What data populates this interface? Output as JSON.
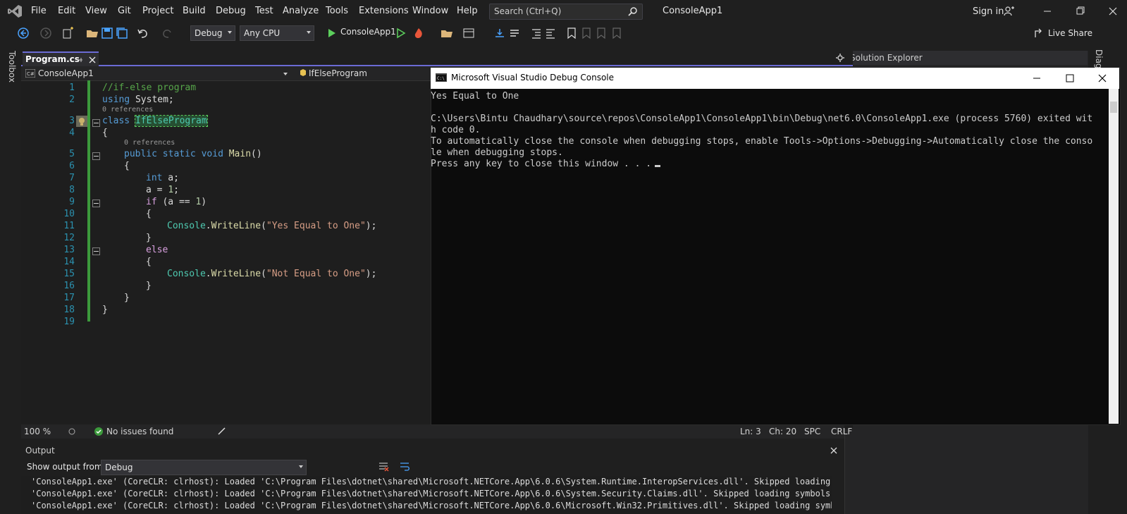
{
  "menu": {
    "items": [
      "File",
      "Edit",
      "View",
      "Git",
      "Project",
      "Build",
      "Debug",
      "Test",
      "Analyze",
      "Tools",
      "Extensions",
      "Window",
      "Help"
    ],
    "search_placeholder": "Search (Ctrl+Q)",
    "app_title": "ConsoleApp1",
    "sign_in": "Sign in"
  },
  "toolbar": {
    "config": "Debug",
    "platform": "Any CPU",
    "run_target": "ConsoleApp1",
    "live_share": "Live Share"
  },
  "sidebar_left": {
    "toolbox": "Toolbox"
  },
  "sidebar_right": {
    "diag": "Diagnostic Tools"
  },
  "editor": {
    "tab_label": "Program.cs",
    "nav_project": "ConsoleApp1",
    "nav_class": "IfElseProgram",
    "line_numbers": [
      "1",
      "2",
      "3",
      "4",
      "5",
      "6",
      "7",
      "8",
      "9",
      "10",
      "11",
      "12",
      "13",
      "14",
      "15",
      "16",
      "17",
      "18",
      "19"
    ],
    "refs_label": "0 references",
    "tokens": {
      "comment": "//if-else program",
      "kw_using": "using",
      "system": " System;",
      "kw_class": "class",
      "class_name": "IfElseProgram",
      "brace_open": "{",
      "brace_close": "}",
      "kw_public": "public",
      "kw_static": "static",
      "kw_void": "void",
      "main": "Main",
      "parens": "()",
      "kw_int": "int",
      "var_a": " a;",
      "assign": "a = ",
      "one": "1",
      "semicolon": ";",
      "kw_if": "if",
      "cond_open": " (a == ",
      "cond_close": ")",
      "console": "Console",
      "dot": ".",
      "writeline": "WriteLine",
      "paren_open": "(",
      "str_yes": "\"Yes Equal to One\"",
      "paren_close_semi": ");",
      "kw_else": "else",
      "str_not": "\"Not Equal to One\""
    }
  },
  "editor_status": {
    "zoom": "100 %",
    "issues": "No issues found",
    "ln": "Ln: 3",
    "ch": "Ch: 20",
    "spc": "SPC",
    "crlf": "CRLF"
  },
  "output": {
    "title": "Output",
    "show_from_label": "Show output from:",
    "show_from_value": "Debug",
    "lines": [
      "'ConsoleApp1.exe' (CoreCLR: clrhost): Loaded 'C:\\Program Files\\dotnet\\shared\\Microsoft.NETCore.App\\6.0.6\\System.Runtime.InteropServices.dll'. Skipped loading symbols",
      "'ConsoleApp1.exe' (CoreCLR: clrhost): Loaded 'C:\\Program Files\\dotnet\\shared\\Microsoft.NETCore.App\\6.0.6\\System.Security.Claims.dll'. Skipped loading symbols. Module",
      "'ConsoleApp1.exe' (CoreCLR: clrhost): Loaded 'C:\\Program Files\\dotnet\\shared\\Microsoft.NETCore.App\\6.0.6\\Microsoft.Win32.Primitives.dll'. Skipped loading symbols. Mo"
    ]
  },
  "solution_explorer": {
    "title": "Solution Explorer"
  },
  "console": {
    "title": "Microsoft Visual Studio Debug Console",
    "lines": [
      "Yes Equal to One",
      "",
      "C:\\Users\\Bintu Chaudhary\\source\\repos\\ConsoleApp1\\ConsoleApp1\\bin\\Debug\\net6.0\\ConsoleApp1.exe (process 5760) exited wit",
      "h code 0.",
      "To automatically close the console when debugging stops, enable Tools->Options->Debugging->Automatically close the conso",
      "le when debugging stops.",
      "Press any key to close this window . . ."
    ]
  },
  "colors": {
    "accent": "#6b6bd4",
    "change_bar": "#3c9a3c",
    "line_number": "#2b91af"
  }
}
